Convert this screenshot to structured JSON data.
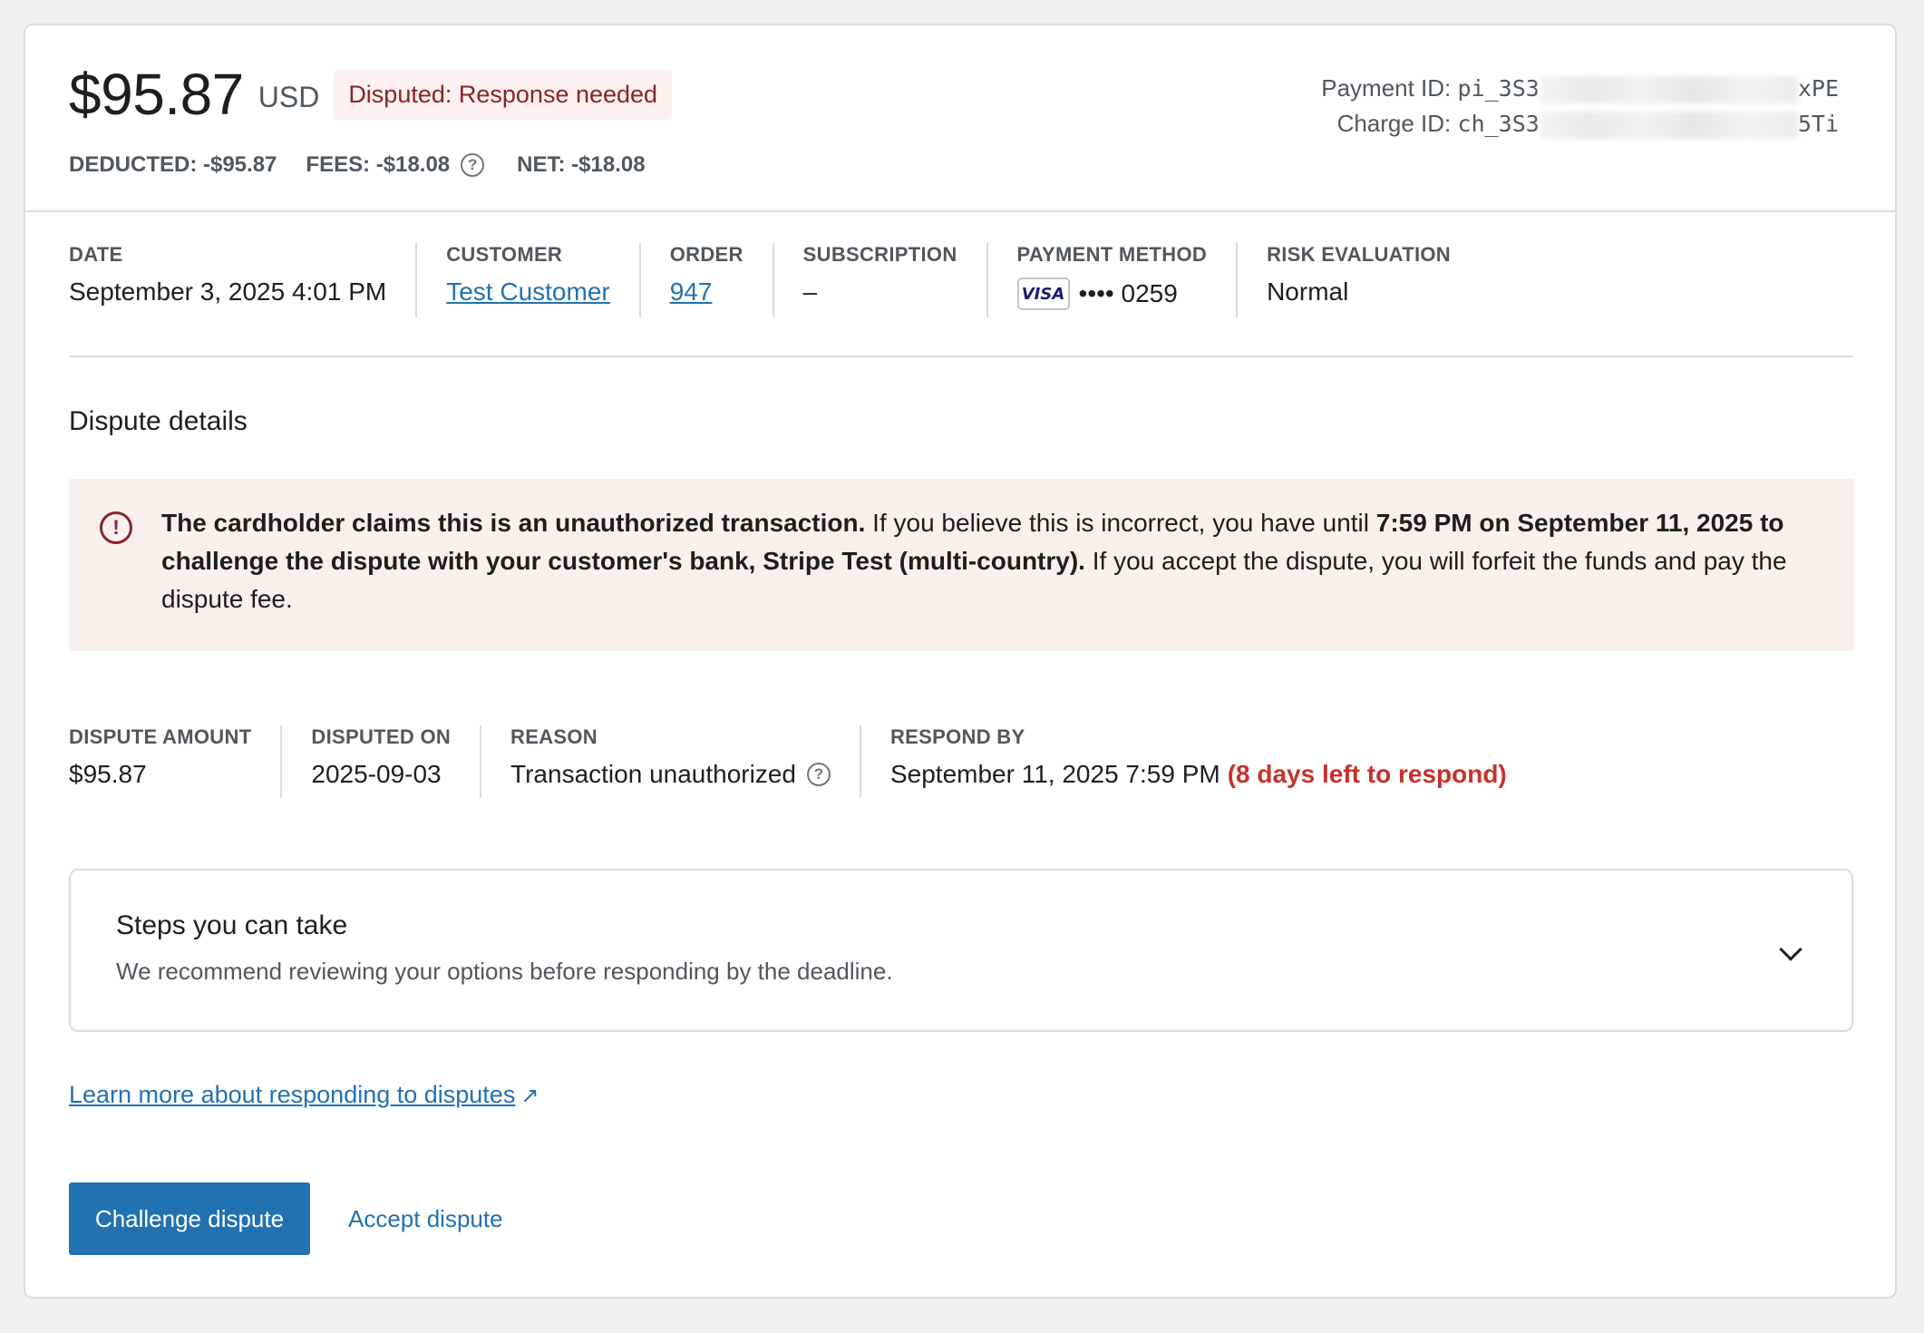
{
  "header": {
    "amount": "$95.87",
    "currency": "USD",
    "status_badge": "Disputed: Response needed",
    "deducted": "DEDUCTED: -$95.87",
    "fees": "FEES: -$18.08",
    "net": "NET: -$18.08",
    "payment_id_label": "Payment ID:",
    "payment_id_prefix": "pi_3S3",
    "payment_id_suffix": "xPE",
    "charge_id_label": "Charge ID:",
    "charge_id_prefix": "ch_3S3",
    "charge_id_suffix": "5Ti"
  },
  "summary": {
    "date_label": "Date",
    "date_value": "September 3, 2025 4:01 PM",
    "customer_label": "Customer",
    "customer_value": "Test Customer",
    "order_label": "Order",
    "order_value": "947",
    "subscription_label": "Subscription",
    "subscription_value": "–",
    "payment_method_label": "Payment method",
    "card_brand": "VISA",
    "card_last4": "•••• 0259",
    "risk_label": "Risk evaluation",
    "risk_value": "Normal"
  },
  "dispute": {
    "section_title": "Dispute details",
    "notice_bold1": "The cardholder claims this is an unauthorized transaction.",
    "notice_text1": " If you believe this is incorrect, you have until ",
    "notice_bold2": "7:59 PM on September 11, 2025 to challenge the dispute with your customer's bank, Stripe Test (multi-country).",
    "notice_text2": " If you accept the dispute, you will forfeit the funds and pay the dispute fee.",
    "amount_label": "Dispute amount",
    "amount_value": "$95.87",
    "disputed_on_label": "Disputed on",
    "disputed_on_value": "2025-09-03",
    "reason_label": "Reason",
    "reason_value": "Transaction unauthorized",
    "respond_by_label": "Respond by",
    "respond_by_value": "September 11, 2025 7:59 PM",
    "days_left": "(8 days left to respond)"
  },
  "steps": {
    "title": "Steps you can take",
    "subtitle": "We recommend reviewing your options before responding by the deadline."
  },
  "learn_more": "Learn more about responding to disputes",
  "actions": {
    "challenge": "Challenge dispute",
    "accept": "Accept dispute"
  },
  "colors": {
    "accent": "#2271b1",
    "badge_bg": "#fcf0f1",
    "badge_text": "#8a2424",
    "notice_bg": "#f9efef",
    "urgent": "#c9302c"
  }
}
